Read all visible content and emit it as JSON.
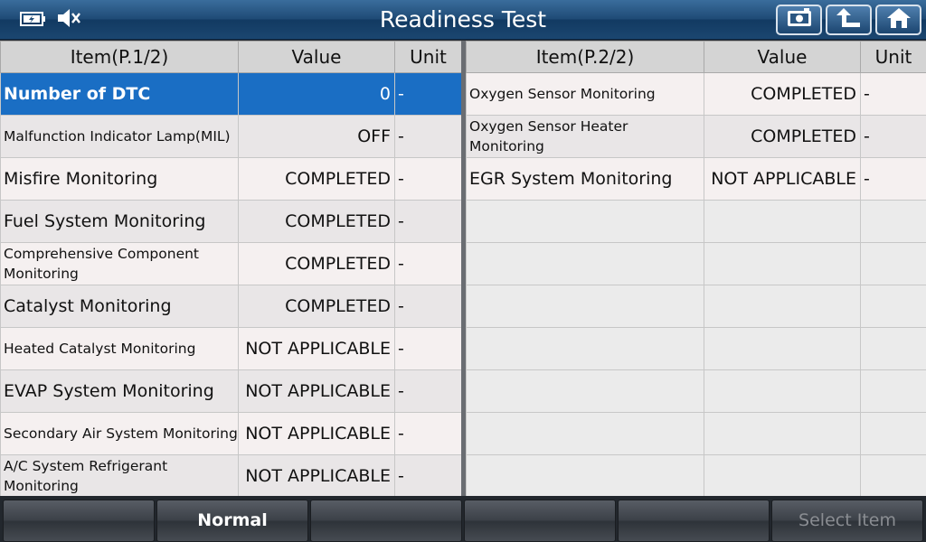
{
  "header": {
    "title": "Readiness Test",
    "icons": [
      "battery-icon",
      "mute-speaker-icon",
      "screenshot-icon",
      "back-up-arrow-icon",
      "home-icon"
    ]
  },
  "left_table": {
    "headers": {
      "item": "Item(P.1/2)",
      "value": "Value",
      "unit": "Unit"
    },
    "rows": [
      {
        "item": "Number of DTC",
        "value": "0",
        "unit": "-"
      },
      {
        "item": "Malfunction Indicator Lamp(MIL)",
        "value": "OFF",
        "unit": "-"
      },
      {
        "item": "Misfire Monitoring",
        "value": "COMPLETED",
        "unit": "-"
      },
      {
        "item": "Fuel System Monitoring",
        "value": "COMPLETED",
        "unit": "-"
      },
      {
        "item": "Comprehensive Component Monitoring",
        "value": "COMPLETED",
        "unit": "-"
      },
      {
        "item": "Catalyst Monitoring",
        "value": "COMPLETED",
        "unit": "-"
      },
      {
        "item": "Heated Catalyst Monitoring",
        "value": "NOT APPLICABLE",
        "unit": "-"
      },
      {
        "item": "EVAP System Monitoring",
        "value": "NOT APPLICABLE",
        "unit": "-"
      },
      {
        "item": "Secondary Air System Monitoring",
        "value": "NOT APPLICABLE",
        "unit": "-"
      },
      {
        "item": "A/C System Refrigerant Monitoring",
        "value": "NOT APPLICABLE",
        "unit": "-"
      }
    ]
  },
  "right_table": {
    "headers": {
      "item": "Item(P.2/2)",
      "value": "Value",
      "unit": "Unit"
    },
    "rows": [
      {
        "item": "Oxygen Sensor Monitoring",
        "value": "COMPLETED",
        "unit": "-"
      },
      {
        "item": "Oxygen Sensor Heater Monitoring",
        "value": "COMPLETED",
        "unit": "-"
      },
      {
        "item": "EGR System Monitoring",
        "value": "NOT APPLICABLE",
        "unit": "-"
      }
    ]
  },
  "footer": {
    "buttons": [
      "",
      "Normal",
      "",
      "",
      "",
      "Select Item"
    ]
  },
  "colors": {
    "selected_row": "#1a6ec4",
    "title_bar": "#1f4b76"
  }
}
